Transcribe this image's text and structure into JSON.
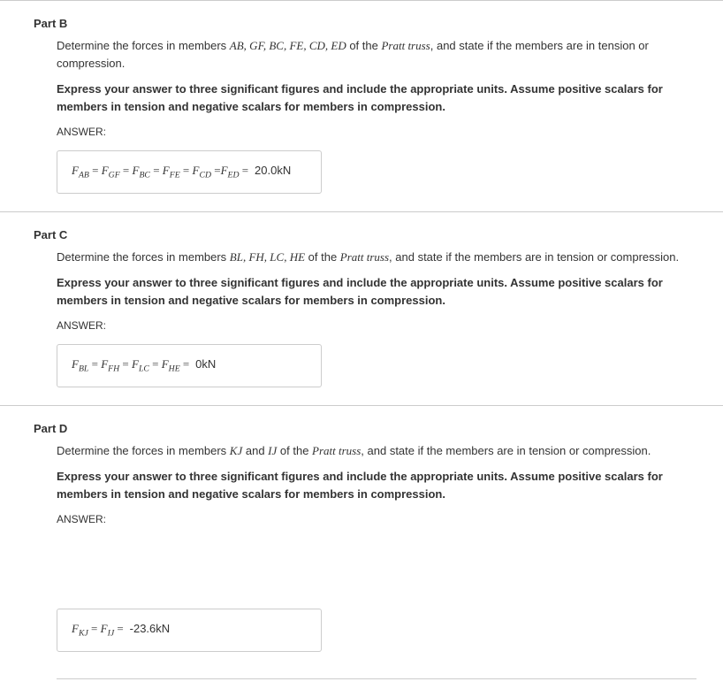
{
  "partB": {
    "title": "Part B",
    "desc_pre": "Determine the forces in members ",
    "members": "AB, GF, BC, FE, CD, ED",
    "desc_mid": " of the ",
    "truss_name": "Pratt truss",
    "desc_post": ", and state if the members are in tension or compression.",
    "instruction": "Express your answer to three significant figures and include the appropriate units. Assume positive scalars for members in tension and negative scalars for members in compression.",
    "answer_label": "ANSWER:",
    "answer_value": "20.0",
    "answer_unit": "kN"
  },
  "partC": {
    "title": "Part C",
    "desc_pre": "Determine the forces in members ",
    "members": "BL, FH, LC, HE",
    "desc_mid": " of the ",
    "truss_name": "Pratt truss",
    "desc_post": ", and state if the members are in tension or compression.",
    "instruction": "Express your answer to three significant figures and include the appropriate units. Assume positive scalars for members in tension and negative scalars for members in compression.",
    "answer_label": "ANSWER:",
    "answer_value": "0",
    "answer_unit": "kN"
  },
  "partD": {
    "title": "Part D",
    "desc_pre": "Determine the forces in members ",
    "members1": "KJ",
    "and": " and ",
    "members2": "IJ",
    "desc_mid": " of the ",
    "truss_name": "Pratt truss",
    "desc_post": ", and state if the members are in tension or compression.",
    "instruction": "Express your answer to three significant figures and include the appropriate units. Assume positive scalars for members in tension and negative scalars for members in compression.",
    "answer_label": "ANSWER:",
    "answer_value": "-23.6",
    "answer_unit": "kN"
  }
}
